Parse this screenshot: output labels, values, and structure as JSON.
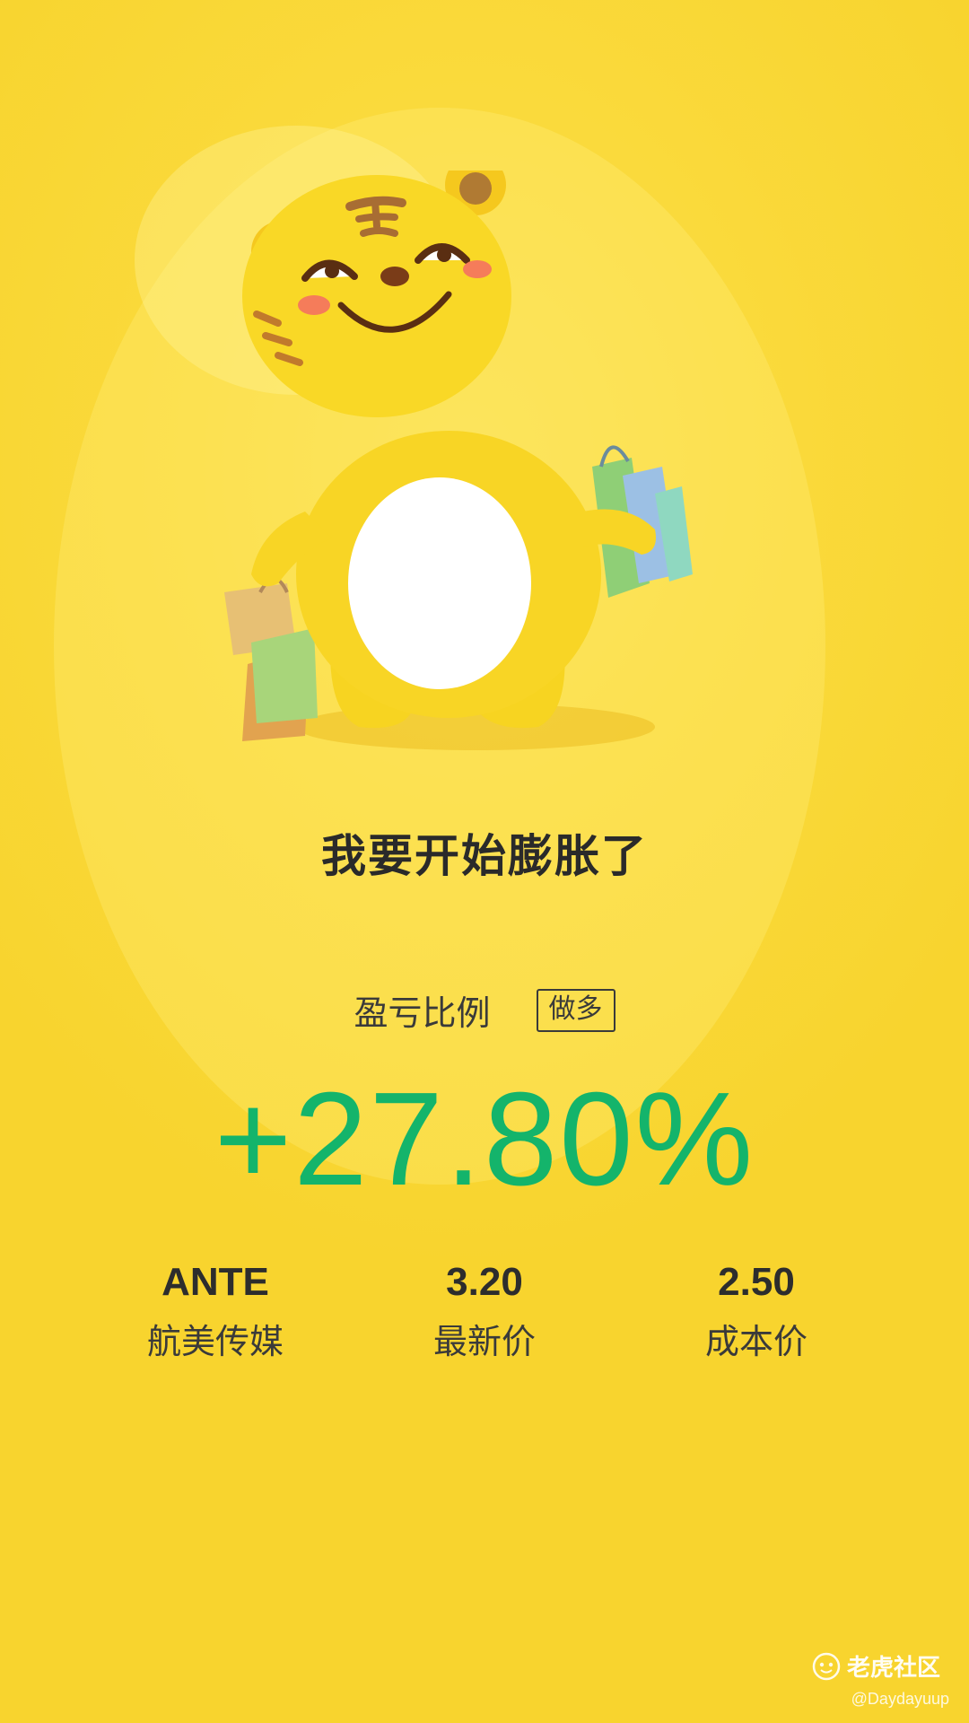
{
  "headline": "我要开始膨胀了",
  "ratio": {
    "label": "盈亏比例",
    "direction_badge": "做多"
  },
  "percent_change": "+27.80%",
  "stats": [
    {
      "value": "ANTE",
      "label": "航美传媒"
    },
    {
      "value": "3.20",
      "label": "最新价"
    },
    {
      "value": "2.50",
      "label": "成本价"
    }
  ],
  "watermark": {
    "brand": "老虎社区",
    "credit": "@Daydayuup"
  },
  "colors": {
    "background": "#f9d83a",
    "gain": "#14b46b",
    "text": "#2b2b2b"
  },
  "mascot": {
    "icon": "tiger-mascot-with-shopping-bags-icon"
  }
}
